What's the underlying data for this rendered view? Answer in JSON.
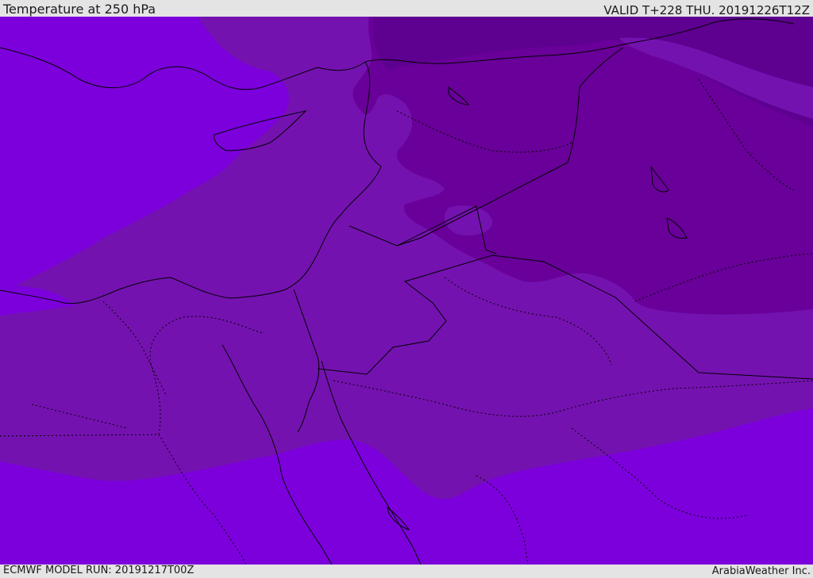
{
  "header": {
    "title": "Temperature at 250 hPa",
    "valid": "VALID T+228 THU. 20191226T12Z"
  },
  "footer": {
    "model_run": "ECMWF MODEL RUN: 20191217T00Z",
    "provider": "ArabiaWeather Inc."
  },
  "colors": {
    "band_warmest": "#7c00dc",
    "band_mid": "#7412b0",
    "band_cold": "#690099",
    "band_coldest": "#5e0090",
    "coastline": "#000000",
    "background": "#e4e4e4"
  }
}
